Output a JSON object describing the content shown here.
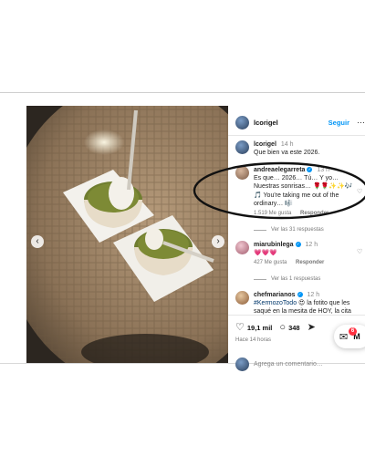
{
  "post": {
    "author": "lcorigel",
    "follow_label": "Seguir",
    "more_icon": "more-icon",
    "caption_user": "lcorigel",
    "caption_time": "14 h",
    "caption_text": "Que bien va este 2026."
  },
  "comments": [
    {
      "user": "andreaelegarreta",
      "verified": true,
      "time": "13 h",
      "text": "Es que… 2026… Tú… Y yo… Nuestras sonrisas… 🌹🌹✨✨🎶 🎵 You're taking me out of the ordinary… 🎼",
      "likes": "1.519 Me gusta",
      "reply_label": "Responder",
      "view_replies": "Ver las 31 respuestas"
    },
    {
      "user": "miarubinlega",
      "verified": true,
      "time": "12 h",
      "text": "💗💗💗",
      "likes": "427 Me gusta",
      "reply_label": "Responder",
      "view_replies": "Ver las 1 respuestas"
    },
    {
      "user": "chefmarianos",
      "verified": true,
      "time": "12 h",
      "hashtag": "#KermozoTodo",
      "text": "😍 la fotito que les saqué en la mesita de HOY, la cita"
    }
  ],
  "actions": {
    "likes_count": "19,1 mil",
    "comments_count": "348",
    "time_ago": "Hace 14 horas"
  },
  "add_comment": {
    "placeholder": "Agrega un comentario…"
  },
  "messages": {
    "badge_count": "6",
    "label": "M"
  }
}
